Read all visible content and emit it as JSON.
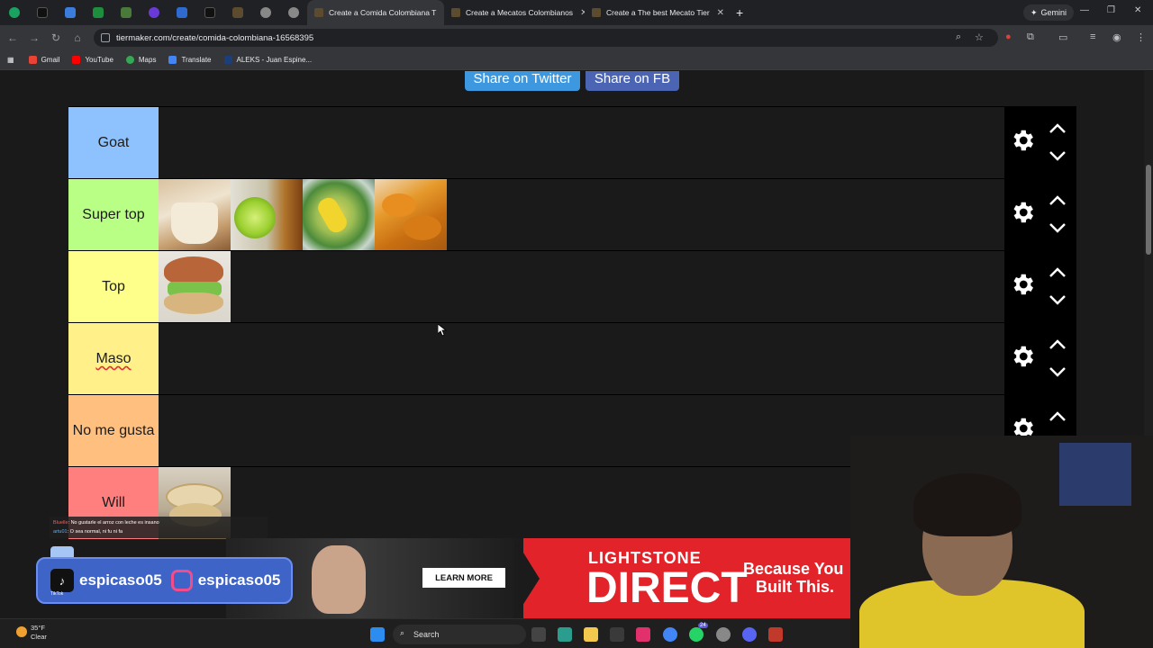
{
  "browser": {
    "tabs": [
      {
        "title": "Create a Comida Colombiana T",
        "active": true
      },
      {
        "title": "Create a Mecatos Colombianos",
        "active": false
      },
      {
        "title": "Create a The best Mecato Tier",
        "active": false
      }
    ],
    "gemini_label": "Gemini",
    "url": "tiermaker.com/create/comida-colombiana-16568395",
    "bookmarks": [
      "Gmail",
      "YouTube",
      "Maps",
      "Translate",
      "ALEKS - Juan Espine..."
    ]
  },
  "page": {
    "share_twitter": "Share on Twitter",
    "share_fb": "Share on FB",
    "tiers": [
      {
        "label": "Goat",
        "color": "#8ec2ff",
        "items": 0
      },
      {
        "label": "Super top",
        "color": "#b9ff85",
        "items": 4
      },
      {
        "label": "Top",
        "color": "#fdff8a",
        "items": 1
      },
      {
        "label": "Maso",
        "color": "#fff08a",
        "items": 0
      },
      {
        "label": "No me gusta",
        "color": "#ffbf7f",
        "items": 0
      },
      {
        "label": "Will",
        "color": "#ff7f7f",
        "items": 1
      }
    ]
  },
  "overlay": {
    "chat": [
      {
        "user": "Bluelle",
        "text": ": No gustarle el arroz con leche es insano"
      },
      {
        "user": "artu01",
        "text": ": O sea normal, ni fu ni fa"
      }
    ],
    "social_tiktok": "espicaso05",
    "social_tiktok_tag": "TikTok",
    "social_instagram": "espicaso05"
  },
  "ad": {
    "learn_more": "LEARN MORE",
    "brand_line1": "LIGHTSTONE",
    "brand_line2": "DIRECT",
    "tagline1": "Because You",
    "tagline2": "Built This."
  },
  "taskbar": {
    "temp": "35°F",
    "condition": "Clear",
    "search": "Search",
    "badge": "24"
  }
}
